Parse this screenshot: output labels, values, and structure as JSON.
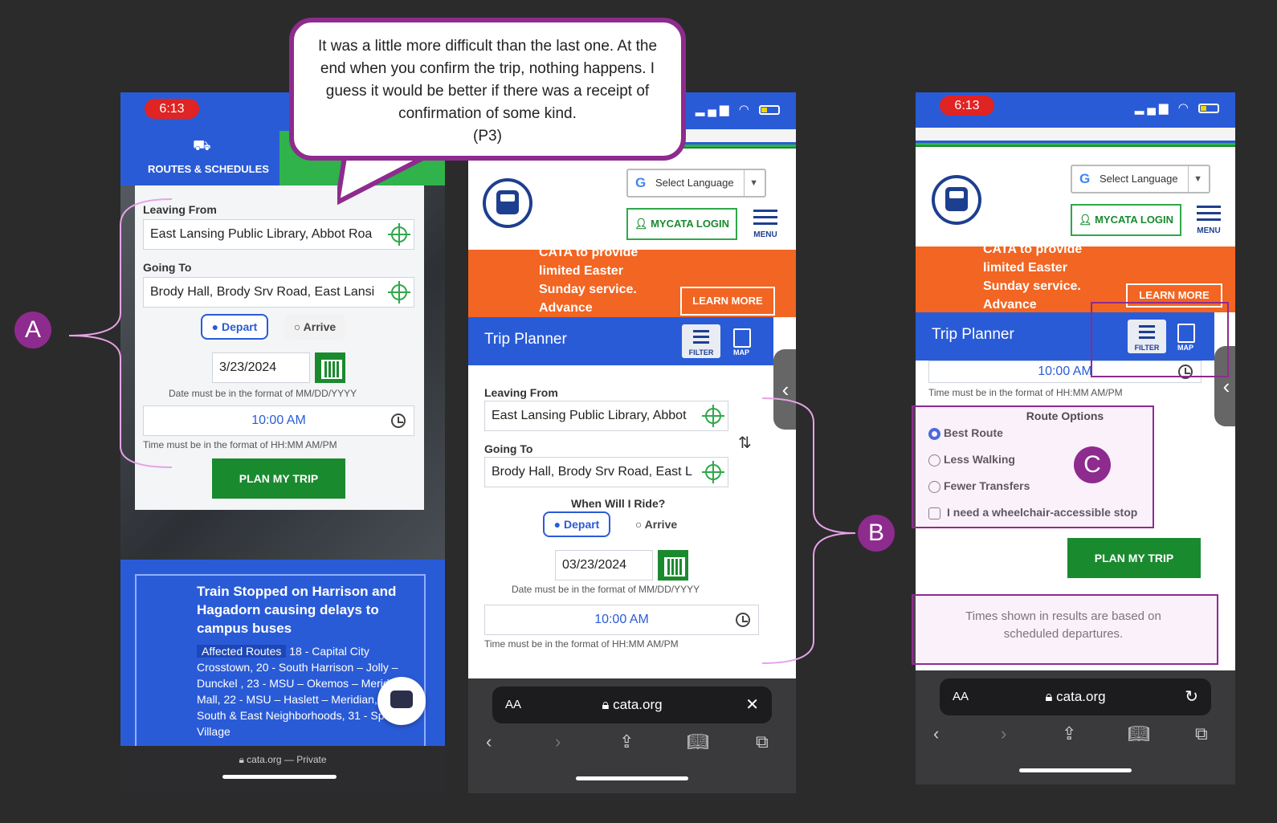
{
  "quote": {
    "text": "It was a little more difficult than the last one. At the end when you confirm the trip, nothing happens. I guess it would be better if there was a receipt of confirmation of some kind.",
    "participant": "(P3)"
  },
  "labels": {
    "a": "A",
    "b": "B",
    "c": "C"
  },
  "phone1": {
    "time": "6:13",
    "tab_label": "ROUTES & SCHEDULES",
    "leaving_from_label": "Leaving From",
    "leaving_from_value": "East Lansing Public Library, Abbot Roa",
    "going_to_label": "Going To",
    "going_to_value": "Brody Hall, Brody Srv Road, East Lansi",
    "depart_label": "Depart",
    "arrive_label": "Arrive",
    "date_value": "3/23/2024",
    "date_hint": "Date must be in the format of MM/DD/YYYY",
    "time_value": "10:00 AM",
    "time_hint": "Time must be in the format of HH:MM AM/PM",
    "plan_button": "PLAN MY TRIP",
    "alert_title": "Train Stopped on Harrison and Hagadorn causing delays to campus buses",
    "affected_label": "Affected Routes",
    "affected_routes": "18 - Capital City Crosstown, 20 - South Harrison – Jolly – Dunckel , 23 - MSU – Okemos – Meridian Mall, 22 - MSU – Haslett – Meridian, 30 - South & East Neighborhoods, 31 - Spartan Village",
    "url": "cata.org — Private"
  },
  "phone2": {
    "select_language": "Select Language",
    "login": "MYCATA LOGIN",
    "menu": "MENU",
    "alert_text": "CATA to provide limited Easter Sunday service. Advance",
    "learn_more": "LEARN MORE",
    "trip_planner": "Trip Planner",
    "filter": "FILTER",
    "map": "MAP",
    "leaving_from_label": "Leaving From",
    "leaving_from_value": "East Lansing Public Library, Abbot",
    "going_to_label": "Going To",
    "going_to_value": "Brody Hall, Brody Srv Road, East L",
    "when_label": "When Will I Ride?",
    "depart_label": "Depart",
    "arrive_label": "Arrive",
    "date_value": "03/23/2024",
    "date_hint": "Date must be in the format of MM/DD/YYYY",
    "time_value": "10:00 AM",
    "time_hint": "Time must be in the format of HH:MM AM/PM",
    "url_aa": "AA",
    "url": "cata.org"
  },
  "phone3": {
    "time": "6:13",
    "select_language": "Select Language",
    "login": "MYCATA LOGIN",
    "menu": "MENU",
    "alert_text": "CATA to provide limited Easter Sunday service. Advance",
    "learn_more": "LEARN MORE",
    "trip_planner": "Trip Planner",
    "filter": "FILTER",
    "map": "MAP",
    "time_value": "10:00 AM",
    "time_hint": "Time must be in the format of HH:MM AM/PM",
    "route_options_title": "Route Options",
    "options": [
      "Best Route",
      "Less Walking",
      "Fewer Transfers",
      "I need a wheelchair-accessible stop"
    ],
    "plan_button": "PLAN MY TRIP",
    "disclaimer": "Times shown in results are based on scheduled departures.",
    "url_aa": "AA",
    "url": "cata.org"
  },
  "colors": {
    "accent_purple": "#8e2b8e",
    "cata_blue": "#2a5bd7",
    "cata_green": "#1a8a2f",
    "alert_orange": "#f26522"
  },
  "icons": [
    "route-icon",
    "crosshair-icon",
    "calendar-icon",
    "clock-icon",
    "swap-icon",
    "filter-icon",
    "map-icon",
    "chat-icon",
    "lock-icon",
    "share-icon",
    "bookmarks-icon",
    "tabs-icon",
    "reload-icon"
  ]
}
